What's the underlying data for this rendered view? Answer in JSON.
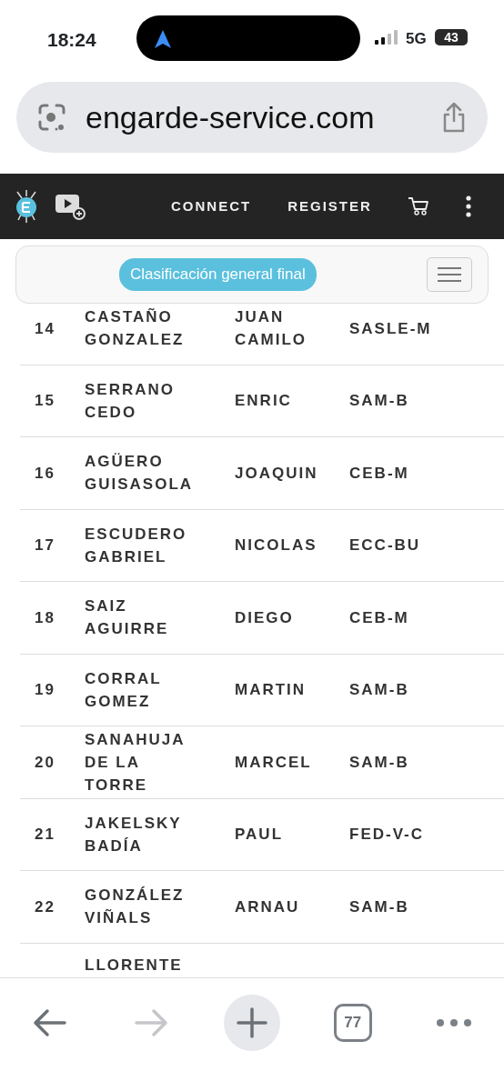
{
  "status_bar": {
    "time": "18:24",
    "network": "5G",
    "battery": "43"
  },
  "browser": {
    "url": "engarde-service.com"
  },
  "site_nav": {
    "links": [
      "CONNECT",
      "REGISTER"
    ]
  },
  "banner": {
    "title": "Clasificación general final"
  },
  "rows": [
    {
      "rank": "14",
      "surname": "CASTAÑO GONZALEZ",
      "first_name": "JUAN CAMILO",
      "club": "SASLE-M"
    },
    {
      "rank": "15",
      "surname": "SERRANO CEDO",
      "first_name": "ENRIC",
      "club": "SAM-B"
    },
    {
      "rank": "16",
      "surname": "AGÜERO GUISASOLA",
      "first_name": "JOAQUIN",
      "club": "CEB-M"
    },
    {
      "rank": "17",
      "surname": "ESCUDERO GABRIEL",
      "first_name": "NICOLAS",
      "club": "ECC-BU"
    },
    {
      "rank": "18",
      "surname": "SAIZ AGUIRRE",
      "first_name": "DIEGO",
      "club": "CEB-M"
    },
    {
      "rank": "19",
      "surname": "CORRAL GOMEZ",
      "first_name": "MARTIN",
      "club": "SAM-B"
    },
    {
      "rank": "20",
      "surname": "SANAHUJA DE LA TORRE",
      "first_name": "MARCEL",
      "club": "SAM-B"
    },
    {
      "rank": "21",
      "surname": "JAKELSKY BADÍA",
      "first_name": "PAUL",
      "club": "FED-V-C"
    },
    {
      "rank": "22",
      "surname": "GONZÁLEZ VIÑALS",
      "first_name": "ARNAU",
      "club": "SAM-B"
    }
  ],
  "partial_row": {
    "surname": "LLORENTE"
  },
  "toolbar": {
    "back": {
      "disabled": false
    },
    "forward": {
      "disabled": true
    },
    "tab_count": "77"
  }
}
